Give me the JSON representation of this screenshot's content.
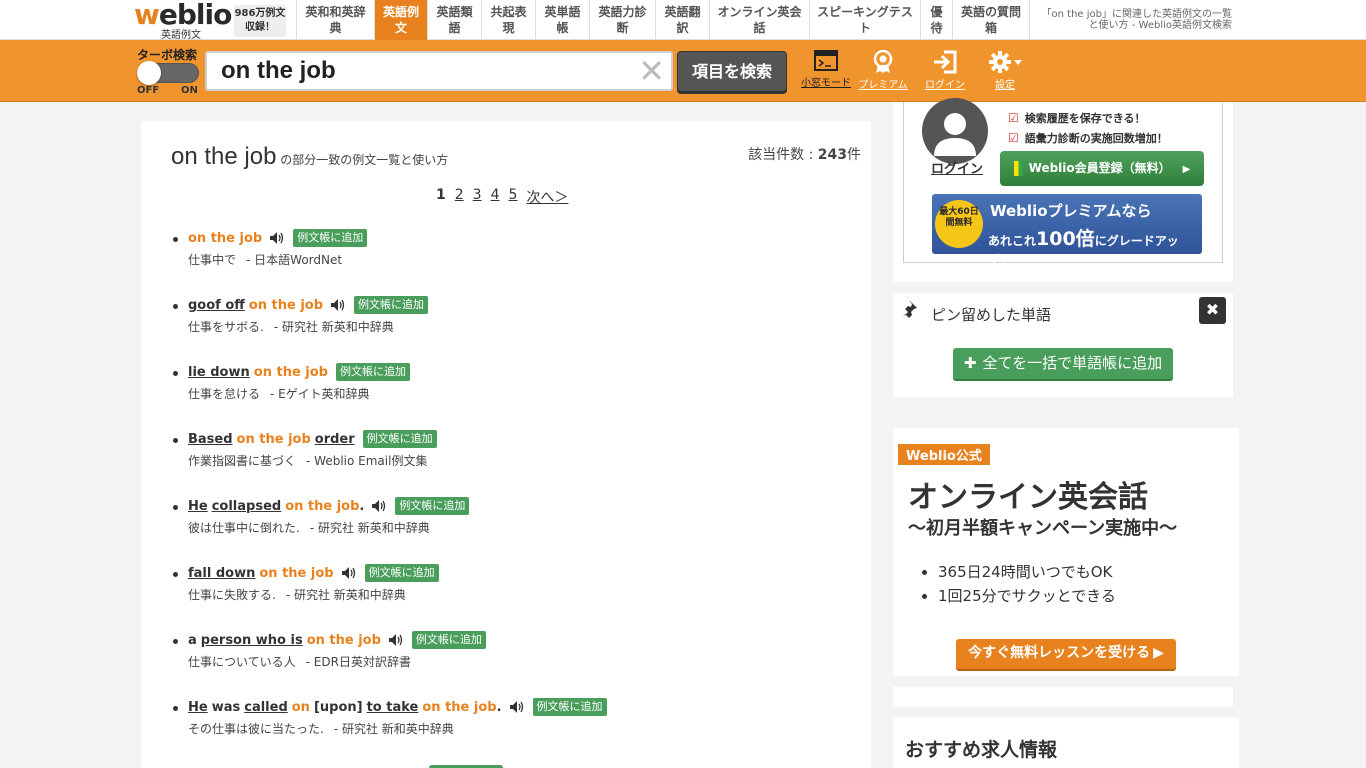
{
  "header": {
    "logo_text_w": "w",
    "logo_text_rest": "eblio",
    "logo_sub": "英語例文",
    "count_badge_l1": "986万例文",
    "count_badge_l2": "収録！",
    "tabs": [
      {
        "label": "英和和英辞典",
        "active": false
      },
      {
        "label": "英語例文",
        "active": true
      },
      {
        "label": "英語類語",
        "active": false
      },
      {
        "label": "共起表現",
        "active": false
      },
      {
        "label": "英単語帳",
        "active": false
      },
      {
        "label": "英語力診断",
        "active": false
      },
      {
        "label": "英語翻訳",
        "active": false
      },
      {
        "label": "オンライン英会話",
        "active": false
      },
      {
        "label": "スピーキングテスト",
        "active": false
      },
      {
        "label": "優待",
        "active": false
      },
      {
        "label": "英語の質問箱",
        "active": false
      }
    ],
    "page_desc": "「on the job」に関連した英語例文の一覧と使い方 - Weblio英語例文検索"
  },
  "searchbar": {
    "turbo_label": "ターボ検索",
    "turbo_off": "OFF",
    "turbo_on": "ON",
    "query": "on the job",
    "clear_icon": "✕",
    "search_button": "項目を検索",
    "tools": {
      "mini_mode": "小窓モード",
      "premium": "プレミアム",
      "login": "ログイン",
      "settings": "設定"
    }
  },
  "main": {
    "title_term": "on the job",
    "title_suffix": " の部分一致の例文一覧と使い方",
    "count_label": "該当件数 : ",
    "count_value": "243",
    "count_unit": "件",
    "pager": [
      "1",
      "2",
      "3",
      "4",
      "5",
      "次へ＞"
    ],
    "add_label": "例文帳に追加",
    "examples": [
      {
        "ja": "仕事中で",
        "src": "- 日本語WordNet"
      },
      {
        "ja": "仕事をサボる.",
        "src": "- 研究社 新英和中辞典"
      },
      {
        "ja": "仕事を怠ける",
        "src": "- Eゲイト英和辞典"
      },
      {
        "ja": "作業指図書に基づく",
        "src": "- Weblio Email例文集"
      },
      {
        "ja": "彼は仕事中に倒れた.",
        "src": "- 研究社 新英和中辞典"
      },
      {
        "ja": "仕事に失敗する.",
        "src": "- 研究社 新英和中辞典"
      },
      {
        "ja": "仕事についている人",
        "src": "- EDR日英対訳辞書"
      },
      {
        "ja": "その仕事は彼に当たった.",
        "src": "- 研究社 新和英中辞典"
      }
    ]
  },
  "login_panel": {
    "login_link": "ログイン",
    "check1": "検索履歴を保存できる！",
    "check2": "語彙力診断の実施回数増加！",
    "register_button": "Weblio会員登録（無料）",
    "premium_seal": "最大60日間無料",
    "premium_l1": "Weblioプレミアムなら",
    "premium_l2a": "あれこれ",
    "premium_l2b": "100倍",
    "premium_l2c": "にグレードアップ！"
  },
  "pin_panel": {
    "title": "ピン留めした単語",
    "add_all": "全てを一括で単語帳に追加"
  },
  "ad_panel": {
    "badge": "Weblio公式",
    "title": "オンライン英会話",
    "subtitle": "～初月半額キャンペーン実施中～",
    "bullets": [
      "365日24時間いつでもOK",
      "1回25分でサクッとできる"
    ],
    "cta": "今すぐ無料レッスンを受ける"
  },
  "jobs_panel": {
    "title": "おすすめ求人情報"
  },
  "colors": {
    "accent": "#e8821e",
    "green": "#4a9e5c",
    "dark": "#555555"
  }
}
